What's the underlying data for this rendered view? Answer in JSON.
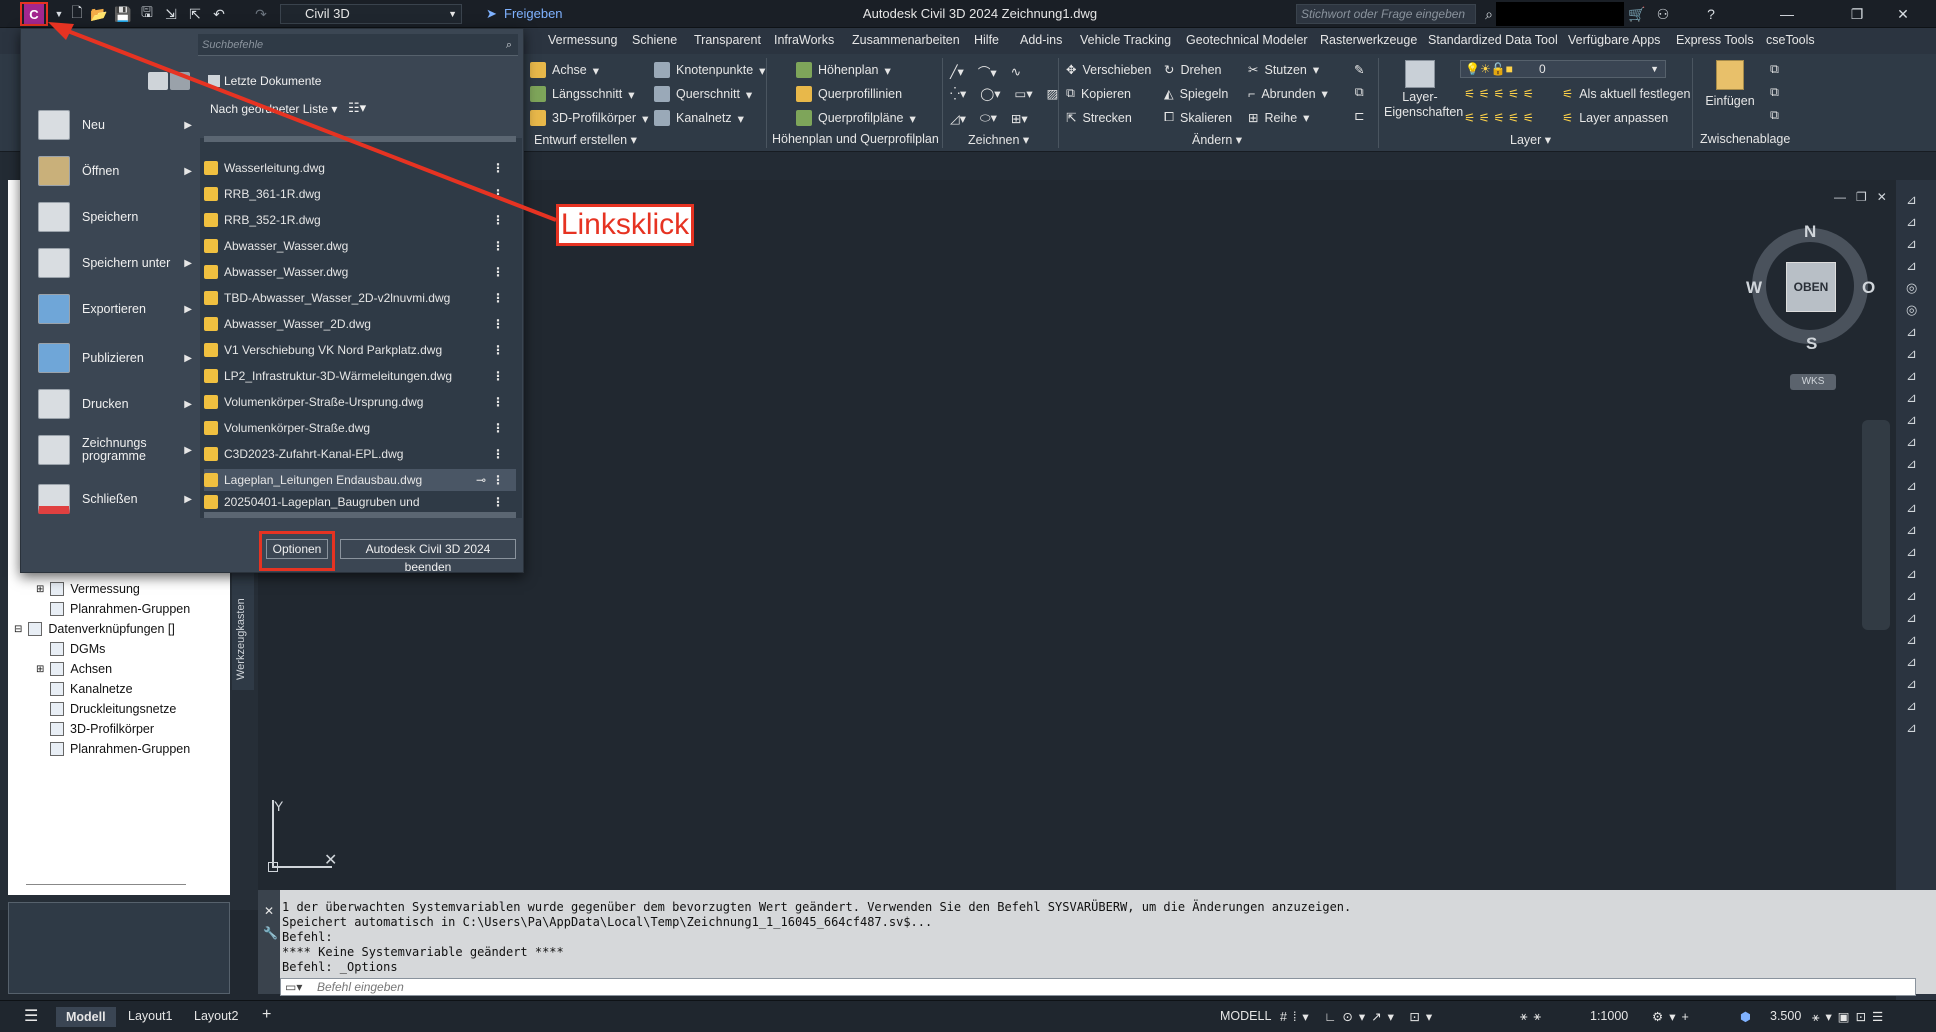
{
  "titlebar": {
    "workspace": "Civil 3D",
    "share": "Freigeben",
    "title": "Autodesk Civil 3D 2024   Zeichnung1.dwg",
    "search_placeholder": "Stichwort oder Frage eingeben"
  },
  "tabs": [
    "Vermessung",
    "Schiene",
    "Transparent",
    "InfraWorks",
    "Zusammenarbeiten",
    "Hilfe",
    "Add-ins",
    "Vehicle Tracking",
    "Geotechnical Modeler",
    "Rasterwerkzeuge",
    "Standardized Data Tool",
    "Verfügbare Apps",
    "Express Tools",
    "cseTools"
  ],
  "ribbon": {
    "entwurf": {
      "items": [
        "Achse",
        "Knotenpunkte",
        "Längsschnitt",
        "Querschnitt",
        "3D-Profilkörper",
        "Kanalnetz"
      ],
      "footer": "Entwurf erstellen"
    },
    "hoehen": {
      "items": [
        "Höhenplan",
        "Querprofillinien",
        "Querprofilpläne"
      ],
      "footer": "Höhenplan und Querprofilplan"
    },
    "zeichnen": {
      "footer": "Zeichnen"
    },
    "aendern": {
      "items": [
        "Verschieben",
        "Drehen",
        "Stutzen",
        "Kopieren",
        "Spiegeln",
        "Abrunden",
        "Strecken",
        "Skalieren",
        "Reihe"
      ],
      "footer": "Ändern"
    },
    "layer": {
      "btn": "Layer-Eigenschaften",
      "current": "0",
      "set_current": "Als aktuell festlegen",
      "match": "Layer anpassen",
      "footer": "Layer"
    },
    "clipboard": {
      "paste": "Einfügen",
      "footer": "Zwischenablage"
    }
  },
  "appmenu": {
    "search_placeholder": "Suchbefehle",
    "recent_title": "Letzte Dokumente",
    "sort": "Nach geordneter Liste",
    "items": [
      "Neu",
      "Öffnen",
      "Speichern",
      "Speichern unter",
      "Exportieren",
      "Publizieren",
      "Drucken",
      "Zeichnungs programme",
      "Schließen"
    ],
    "files": [
      "Wasserleitung.dwg",
      "RRB_361-1R.dwg",
      "RRB_352-1R.dwg",
      "Abwasser_Wasser.dwg",
      "Abwasser_Wasser.dwg",
      "TBD-Abwasser_Wasser_2D-v2lnuvmi.dwg",
      "Abwasser_Wasser_2D.dwg",
      "V1 Verschiebung VK Nord Parkplatz.dwg",
      "LP2_Infrastruktur-3D-Wärmeleitungen.dwg",
      "Volumenkörper-Straße-Ursprung.dwg",
      "Volumenkörper-Straße.dwg",
      "C3D2023-Zufahrt-Kanal-EPL.dwg",
      "Lageplan_Leitungen Endausbau.dwg",
      "20250401-Lageplan_Baugruben und"
    ],
    "options_btn": "Optionen",
    "exit_btn": "Autodesk Civil 3D 2024 beenden"
  },
  "tree": {
    "items": [
      "Vermessung",
      "Planrahmen-Gruppen",
      "Datenverknüpfungen []",
      "DGMs",
      "Achsen",
      "Kanalnetze",
      "Druckleitungsnetze",
      "3D-Profilkörper",
      "Planrahmen-Gruppen"
    ]
  },
  "toolbox_label": "Werkzeugkasten",
  "viewcube": {
    "n": "N",
    "s": "S",
    "w": "W",
    "o": "O",
    "face": "OBEN",
    "wcs": "WKS"
  },
  "callout": "Linksklick",
  "command": {
    "lines": [
      "1 der überwachten Systemvariablen wurde gegenüber dem bevorzugten Wert geändert. Verwenden Sie den Befehl SYSVARÜBERW, um die Änderungen anzuzeigen.",
      "Speichert automatisch in C:\\Users\\Pa\\AppData\\Local\\Temp\\Zeichnung1_1_16045_664cf487.sv$...",
      "Befehl:",
      "**** Keine Systemvariable geändert ****",
      "Befehl: _Options"
    ],
    "input_placeholder": "Befehl eingeben"
  },
  "status": {
    "tabs": [
      "Modell",
      "Layout1",
      "Layout2"
    ],
    "mode": "MODELL",
    "scale": "1:1000",
    "value": "3.500"
  },
  "axis": {
    "y": "Y"
  }
}
